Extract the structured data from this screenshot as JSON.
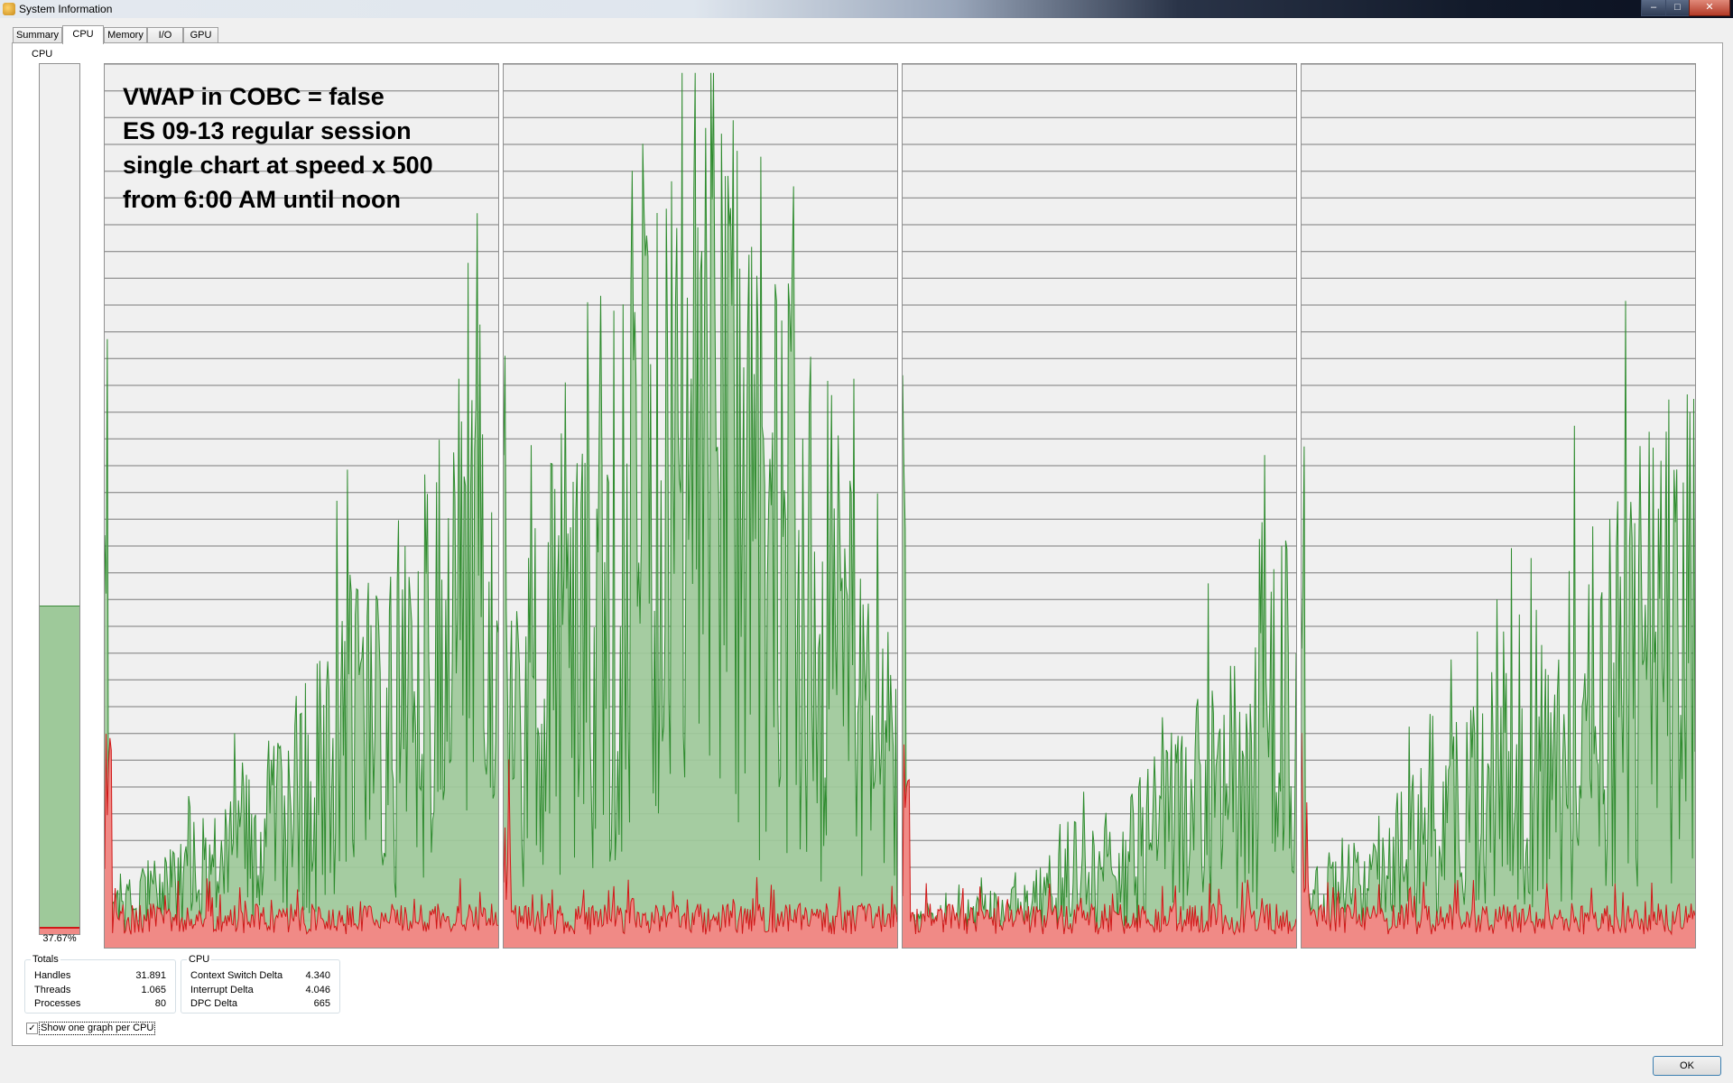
{
  "window": {
    "title": "System Information",
    "minimize": "–",
    "maximize": "□",
    "close": "✕"
  },
  "tabs": [
    {
      "label": "Summary"
    },
    {
      "label": "CPU",
      "active": true
    },
    {
      "label": "Memory"
    },
    {
      "label": "I/O"
    },
    {
      "label": "GPU"
    }
  ],
  "cpu": {
    "label": "CPU",
    "usage_percent": 37.67,
    "usage_text": "37.67%",
    "kernel_percent": 0.6
  },
  "overlay_lines": [
    "VWAP in COBC = false",
    "ES 09-13 regular session",
    "single chart at speed x 500",
    "from 6:00 AM until noon"
  ],
  "graphs": [
    {
      "name": "cpu-0",
      "profile": "rising-late"
    },
    {
      "name": "cpu-1",
      "profile": "high"
    },
    {
      "name": "cpu-2",
      "profile": "low"
    },
    {
      "name": "cpu-3",
      "profile": "rising-mid"
    }
  ],
  "colors": {
    "total_line": "#2e8b2e",
    "total_fill": "#9ec99a",
    "kernel_line": "#d01818",
    "kernel_fill": "#f08a86",
    "grid": "#7a7a7a",
    "bg": "#f0f0f0"
  },
  "totals": {
    "title": "Totals",
    "rows": [
      {
        "label": "Handles",
        "value": "31.891"
      },
      {
        "label": "Threads",
        "value": "1.065"
      },
      {
        "label": "Processes",
        "value": "80"
      }
    ]
  },
  "cpu_stats": {
    "title": "CPU",
    "rows": [
      {
        "label": "Context Switch Delta",
        "value": "4.340"
      },
      {
        "label": "Interrupt Delta",
        "value": "4.046"
      },
      {
        "label": "DPC Delta",
        "value": "665"
      }
    ]
  },
  "show_one_graph": {
    "label": "Show one graph per CPU",
    "checked": "✓"
  },
  "ok_button": "OK"
}
